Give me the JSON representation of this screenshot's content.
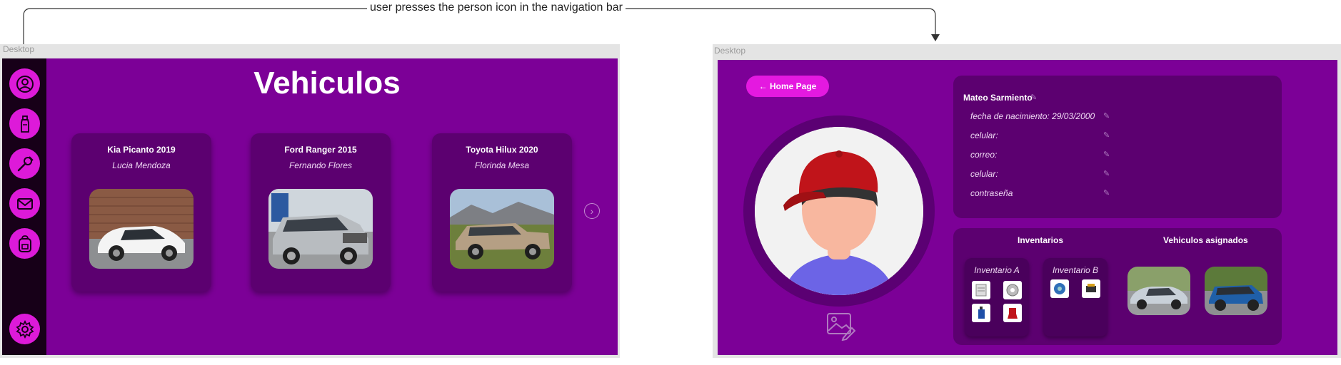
{
  "annotation": {
    "text": "user presses the person icon in the navigation bar"
  },
  "frames": {
    "left_label": "Desktop",
    "right_label": "Desktop"
  },
  "colors": {
    "screen_bg": "#7c0097",
    "card_bg": "#5c0070",
    "sidebar_bg": "#170018",
    "accent": "#dd1ad9"
  },
  "screen1": {
    "title": "Vehiculos",
    "nav_icons": [
      "person-icon",
      "bottle-icon",
      "wrench-icon",
      "mail-icon",
      "backpack-icon",
      "gear-icon"
    ],
    "vehicles": [
      {
        "name": "Kia Picanto 2019",
        "owner": "Lucia Mendoza"
      },
      {
        "name": "Ford Ranger 2015",
        "owner": "Fernando Flores"
      },
      {
        "name": "Toyota Hilux 2020",
        "owner": "Florinda Mesa"
      }
    ],
    "next_icon": "chevron-right-icon"
  },
  "screen2": {
    "home_button": "← Home Page",
    "profile": {
      "name": "Mateo Sarmiento",
      "fields": [
        "fecha de nacimiento: 29/03/2000",
        "celular:",
        "correo:",
        "celular:",
        "contraseña"
      ]
    },
    "inventories_title": "Inventarios",
    "inventories": [
      {
        "title": "Inventario A"
      },
      {
        "title": "Inventario B"
      }
    ],
    "assigned_title": "Vehiculos asignados",
    "edit_image_icon": "image-edit-icon"
  }
}
